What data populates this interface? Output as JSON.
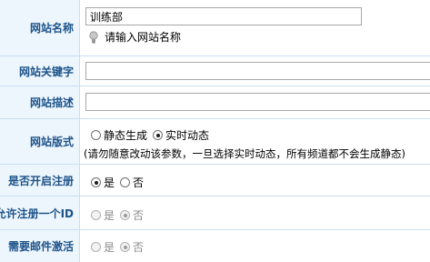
{
  "fields": {
    "site_name": {
      "label": "网站名称",
      "value": "训练部",
      "hint": "请输入网站名称"
    },
    "site_keywords": {
      "label": "网站关键字",
      "value": ""
    },
    "site_description": {
      "label": "网站描述",
      "value": ""
    },
    "site_mode": {
      "label": "网站版式",
      "options": [
        "静态生成",
        "实时动态"
      ],
      "selected": "实时动态",
      "note": "(请勿随意改动该参数，一旦选择实时动态，所有频道都不会生成静态)"
    },
    "enable_register": {
      "label": "是否开启注册",
      "options": [
        "是",
        "否"
      ],
      "selected": "是"
    },
    "allow_one_id": {
      "label": "允许注册一个ID",
      "options": [
        "是",
        "否"
      ],
      "selected": "否",
      "disabled": true
    },
    "require_email": {
      "label": "需要邮件激活",
      "options": [
        "是",
        "否"
      ],
      "selected": "否",
      "disabled": true
    }
  },
  "colors": {
    "label_text": "#1c5389",
    "label_bg": "#edf5fd",
    "border": "#c9dff3"
  },
  "icons": {
    "hint": "lightbulb-icon"
  }
}
